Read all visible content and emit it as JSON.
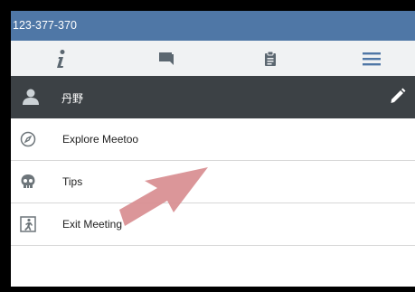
{
  "title": "123-377-370",
  "toolbar": {
    "buttons": [
      {
        "icon": "info-icon"
      },
      {
        "icon": "chat-icon"
      },
      {
        "icon": "clipboard-icon"
      },
      {
        "icon": "hamburger-menu-icon"
      }
    ]
  },
  "user": {
    "name": "丹野",
    "icon": "user-icon",
    "edit_icon": "pencil-icon"
  },
  "menu": {
    "items": [
      {
        "label": "Explore Meetoo",
        "icon": "compass-icon"
      },
      {
        "label": "Tips",
        "icon": "skull-icon"
      },
      {
        "label": "Exit Meeting",
        "icon": "exit-icon"
      }
    ]
  },
  "colors": {
    "titlebar": "#4f77a6",
    "toolbar": "#f0f2f3",
    "userbar": "#3c4145",
    "arrow": "#d88d90"
  }
}
